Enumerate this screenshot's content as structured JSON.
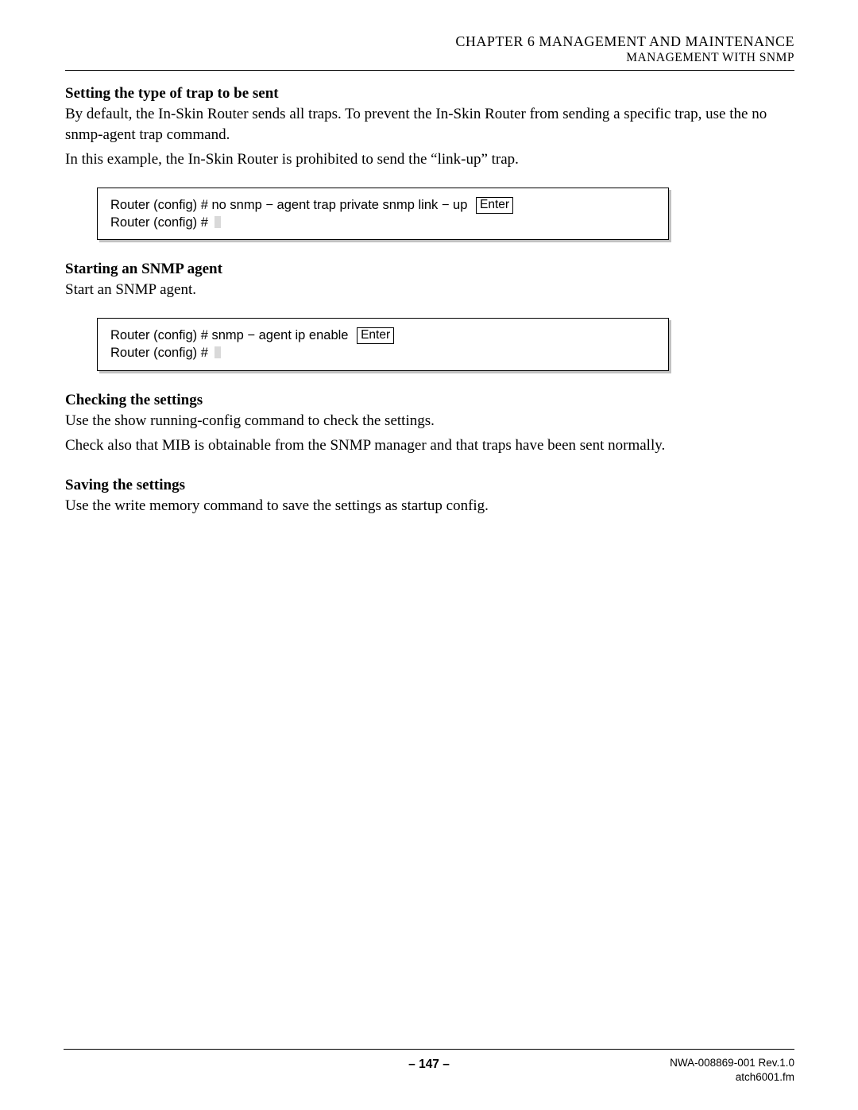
{
  "header": {
    "chapter": "CHAPTER 6   MANAGEMENT AND MAINTENANCE",
    "section": "MANAGEMENT WITH SNMP"
  },
  "sections": {
    "trap": {
      "heading": "Setting the type of trap to be sent",
      "p1": "By default, the In-Skin Router sends all traps. To prevent the In-Skin Router from sending a specific trap, use the no snmp-agent trap command.",
      "p2": "In this example, the In-Skin Router is prohibited to send the “link-up” trap."
    },
    "code1": {
      "line1": "Router (config) # no snmp − agent trap private snmp link − up",
      "enter": "Enter",
      "line2": "Router (config) #"
    },
    "start": {
      "heading": "Starting an SNMP agent",
      "p1": "Start an SNMP agent."
    },
    "code2": {
      "line1": "Router (config) # snmp − agent ip enable",
      "enter": "Enter",
      "line2": "Router (config) #"
    },
    "check": {
      "heading": "Checking the settings",
      "p1": "Use the show running-config command to check the settings.",
      "p2": "Check also that MIB is obtainable from the SNMP manager and that traps have been sent normally."
    },
    "save": {
      "heading": "Saving the settings",
      "p1": "Use the write memory command to save the settings as startup config."
    }
  },
  "footer": {
    "page": "– 147 –",
    "doc": "NWA-008869-001 Rev.1.0",
    "file": "atch6001.fm"
  }
}
